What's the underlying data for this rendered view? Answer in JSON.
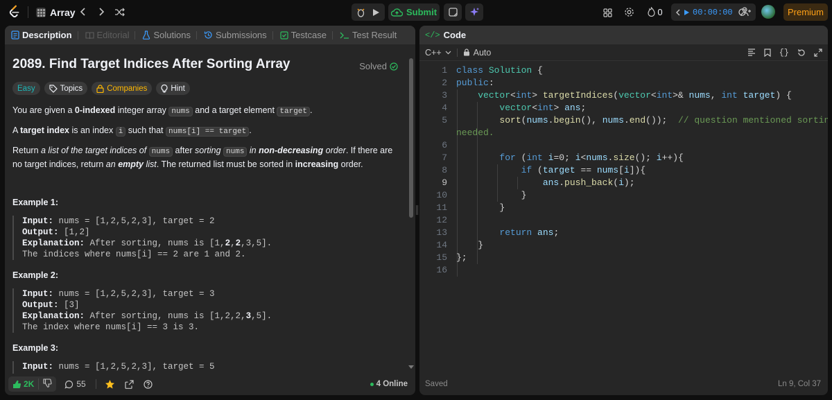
{
  "topbar": {
    "problem_list_label": "Array",
    "submit_label": "Submit",
    "streak_count": "0",
    "timer": "00:00:00",
    "premium_label": "Premium"
  },
  "left_tabs": {
    "description": "Description",
    "editorial": "Editorial",
    "solutions": "Solutions",
    "submissions": "Submissions",
    "testcase": "Testcase",
    "test_result": "Test Result"
  },
  "problem": {
    "title": "2089. Find Target Indices After Sorting Array",
    "status": "Solved",
    "tags": {
      "difficulty": "Easy",
      "topics": "Topics",
      "companies": "Companies",
      "hint": "Hint"
    },
    "p1_a": "You are given a ",
    "p1_b": "0-indexed",
    "p1_c": " integer array ",
    "p1_code1": "nums",
    "p1_d": " and a target element ",
    "p1_code2": "target",
    "p1_e": ".",
    "p2_a": "A ",
    "p2_b": "target index",
    "p2_c": " is an index ",
    "p2_code1": "i",
    "p2_d": " such that ",
    "p2_code2": "nums[i] == target",
    "p2_e": ".",
    "p3_a": "Return ",
    "p3_b": "a list of the target indices of ",
    "p3_code1": "nums",
    "p3_c": " after ",
    "p3_d": "sorting ",
    "p3_code2": "nums",
    "p3_e": " in ",
    "p3_f": "non-decreasing",
    "p3_g": " order",
    "p3_h": ". If there are no target indices, return ",
    "p3_i": "an ",
    "p3_j": "empty",
    "p3_k": " list",
    "p3_l": ". The returned list must be sorted in ",
    "p3_m": "increasing",
    "p3_n": " order."
  },
  "examples": [
    {
      "heading": "Example 1:",
      "input_label": "Input:",
      "input": " nums = [1,2,5,2,3], target = 2",
      "output_label": "Output:",
      "output": " [1,2]",
      "explanation_label": "Explanation:",
      "explanation_a": " After sorting, nums is [1,",
      "explanation_b": "2",
      "explanation_c": ",",
      "explanation_d": "2",
      "explanation_e": ",3,5].",
      "explanation_2": "The indices where nums[i] == 2 are 1 and 2."
    },
    {
      "heading": "Example 2:",
      "input_label": "Input:",
      "input": " nums = [1,2,5,2,3], target = 3",
      "output_label": "Output:",
      "output": " [3]",
      "explanation_label": "Explanation:",
      "explanation_a": " After sorting, nums is [1,2,2,",
      "explanation_b": "3",
      "explanation_c": ",5].",
      "explanation_2": "The index where nums[i] == 3 is 3."
    },
    {
      "heading": "Example 3:",
      "input_label": "Input:",
      "input": " nums = [1,2,5,2,3], target = 5"
    }
  ],
  "bottom": {
    "likes": "2K",
    "comments": "55",
    "online": "4 Online"
  },
  "code_panel": {
    "title": "Code",
    "language": "C++",
    "autosave": "Auto",
    "status": "Saved",
    "cursor": "Ln 9, Col 37",
    "lines": [
      "class Solution {",
      "public:",
      "    vector<int> targetIndices(vector<int>& nums, int target) {",
      "        vector<int> ans;",
      "        sort(nums.begin(), nums.end());  // question mentioned sorting",
      "needed.",
      "",
      "        for (int i=0; i<nums.size(); i++){",
      "            if (target == nums[i]){",
      "                ans.push_back(i);",
      "            }",
      "        }",
      "",
      "        return ans;",
      "    }",
      "};",
      ""
    ],
    "line_numbers": [
      "1",
      "2",
      "3",
      "4",
      "5",
      "",
      "6",
      "7",
      "8",
      "9",
      "10",
      "11",
      "12",
      "13",
      "14",
      "15",
      "16"
    ]
  },
  "colors": {
    "accent_green": "#2cbb5d",
    "premium": "#ffa116",
    "easy": "#1cb8b8",
    "companies": "#ffb800",
    "timer_blue": "#3b9cff"
  },
  "icons": [
    "leetcode-logo",
    "list-icon",
    "chevron-left-icon",
    "chevron-right-icon",
    "shuffle-icon",
    "debug-icon",
    "play-icon",
    "cloud-upload-icon",
    "note-icon",
    "sparkle-icon",
    "layout-icon",
    "gear-icon",
    "fire-icon",
    "refresh-icon",
    "add-user-icon",
    "avatar"
  ]
}
